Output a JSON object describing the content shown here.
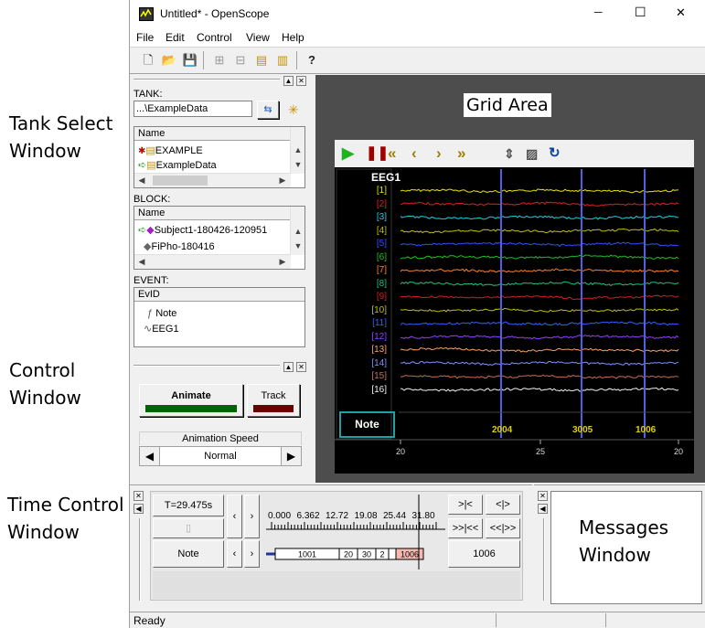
{
  "annotations": {
    "tank_select": [
      "Tank Select",
      "Window"
    ],
    "control": [
      "Control",
      "Window"
    ],
    "time_control": [
      "Time Control",
      "Window"
    ],
    "messages": [
      "Messages",
      "Window"
    ],
    "grid_area": "Grid Area"
  },
  "window": {
    "title": "Untitled* - OpenScope",
    "minimize": "─",
    "maximize": "☐",
    "close": "✕"
  },
  "menu": [
    "File",
    "Edit",
    "Control",
    "View",
    "Help"
  ],
  "tank": {
    "label": "TANK:",
    "path": "...\\ExampleData",
    "header": "Name",
    "items": [
      "EXAMPLE",
      "ExampleData"
    ]
  },
  "block": {
    "label": "BLOCK:",
    "header": "Name",
    "items": [
      "Subject1-180426-120951",
      "FiPho-180416"
    ]
  },
  "event": {
    "label": "EVENT:",
    "header": "EvID",
    "items": [
      "Note",
      "EEG1"
    ]
  },
  "control": {
    "animate_label": "Animate",
    "track_label": "Track",
    "animation_speed_label": "Animation Speed",
    "speed_value": "Normal"
  },
  "scope": {
    "title": "EEG1",
    "channels": [
      "[1]",
      "[2]",
      "[3]",
      "[4]",
      "[5]",
      "[6]",
      "[7]",
      "[8]",
      "[9]",
      "[10]",
      "[11]",
      "[12]",
      "[13]",
      "[14]",
      "[15]",
      "[16]"
    ],
    "channel_colors": [
      "#e6e600",
      "#e02020",
      "#20d0e0",
      "#c0c000",
      "#3050ff",
      "#20c020",
      "#ff8020",
      "#20c080",
      "#d02020",
      "#c0c000",
      "#3060ff",
      "#9040ff",
      "#ffa060",
      "#8090ff",
      "#c07050",
      "#f0f0f0"
    ],
    "note_button": "Note",
    "note_markers": [
      "2004",
      "3005",
      "1006"
    ],
    "x_ticks": [
      "20",
      "25",
      "20"
    ]
  },
  "time_control": {
    "time_value": "T=29.475s",
    "note_label": "Note",
    "ruler_ticks": [
      "0.000",
      "6.362",
      "12.72",
      "19.08",
      "25.44",
      "31.80"
    ],
    "segments": [
      "1001",
      "20",
      "30",
      "2",
      "",
      "1006"
    ],
    "note_value": "1006",
    "nav_buttons": [
      ">|<",
      "<|>",
      ">>|<<",
      "<<|>>"
    ]
  },
  "status": {
    "text": "Ready"
  }
}
